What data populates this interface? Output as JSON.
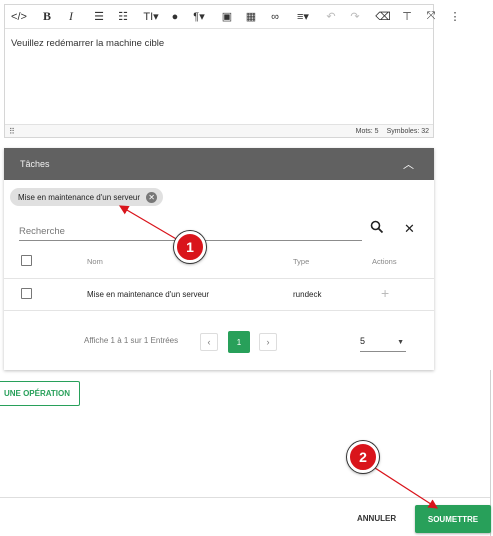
{
  "toolbar": {
    "items": [
      {
        "name": "code-view-icon",
        "glyph": "</>"
      },
      {
        "name": "bold-icon",
        "glyph": "B"
      },
      {
        "name": "italic-icon",
        "glyph": "I"
      },
      {
        "name": "bullet-list-icon",
        "glyph": "☰"
      },
      {
        "name": "numbered-list-icon",
        "glyph": "☷"
      },
      {
        "name": "font-size-icon",
        "glyph": "TI▾"
      },
      {
        "name": "text-color-icon",
        "glyph": "●"
      },
      {
        "name": "paragraph-icon",
        "glyph": "¶▾"
      },
      {
        "name": "image-icon",
        "glyph": "▣"
      },
      {
        "name": "table-icon",
        "glyph": "▦"
      },
      {
        "name": "link-icon",
        "glyph": "∞"
      },
      {
        "name": "align-icon",
        "glyph": "≡▾"
      },
      {
        "name": "undo-icon",
        "glyph": "↶"
      },
      {
        "name": "redo-icon",
        "glyph": "↷"
      },
      {
        "name": "eraser-icon",
        "glyph": "⌫"
      },
      {
        "name": "format-painter-icon",
        "glyph": "⊤"
      },
      {
        "name": "fullscreen-icon",
        "glyph": "⤧"
      },
      {
        "name": "more-icon",
        "glyph": "⋮"
      }
    ]
  },
  "editor": {
    "content": "Veuillez redémarrer la machine cible",
    "words_label": "Mots: 5",
    "symbols_label": "Symboles: 32",
    "grip_icon": "⠿"
  },
  "tasks": {
    "title": "Tâches",
    "chip_label": "Mise en maintenance d'un serveur",
    "search_placeholder": "Recherche",
    "columns": {
      "name": "Nom",
      "type": "Type",
      "actions": "Actions"
    },
    "rows": [
      {
        "name": "Mise en maintenance d'un serveur",
        "type": "rundeck",
        "action": "+"
      }
    ],
    "pager_text": "Affiche 1 à 1 sur 1 Entrées",
    "current_page": "1",
    "per_page": "5"
  },
  "add_operation_label": "UNE OPÉRATION",
  "footer": {
    "cancel_label": "ANNULER",
    "submit_label": "SOUMETTRE"
  },
  "callouts": [
    "1",
    "2"
  ],
  "colors": {
    "accent": "#28a05a",
    "header": "#616161",
    "callout": "#d9141b"
  }
}
